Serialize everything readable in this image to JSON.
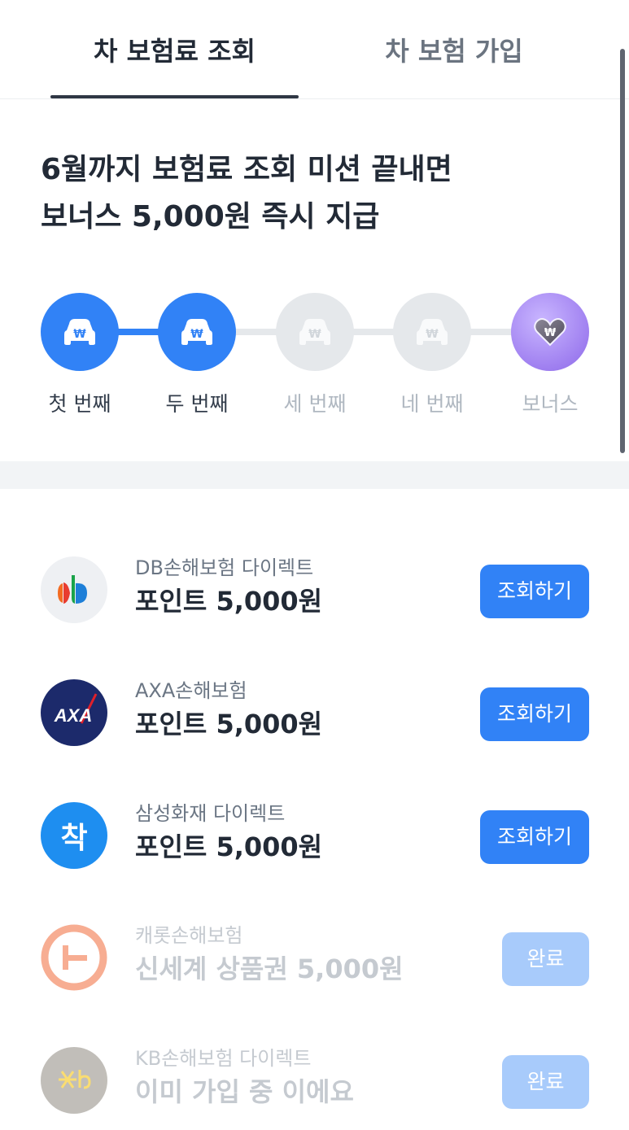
{
  "tabs": [
    {
      "label": "차 보험료 조회",
      "active": true
    },
    {
      "label": "차 보험 가입",
      "active": false
    }
  ],
  "headline": {
    "line1": "6월까지 보험료 조회 미션 끝내면",
    "line2": "보너스 5,000원 즉시 지급"
  },
  "steps": [
    {
      "label": "첫 번째",
      "status": "done",
      "icon": "car-won-icon"
    },
    {
      "label": "두 번째",
      "status": "done",
      "icon": "car-won-icon"
    },
    {
      "label": "세 번째",
      "status": "todo",
      "icon": "car-won-icon"
    },
    {
      "label": "네 번째",
      "status": "todo",
      "icon": "car-won-icon"
    },
    {
      "label": "보너스",
      "status": "bonus",
      "icon": "won-heart-icon"
    }
  ],
  "insurers": [
    {
      "name": "DB손해보험 다이렉트",
      "reward": "포인트 5,000원",
      "button": "조회하기",
      "state": "available",
      "logo": "db-logo"
    },
    {
      "name": "AXA손해보험",
      "reward": "포인트 5,000원",
      "button": "조회하기",
      "state": "available",
      "logo": "axa-logo"
    },
    {
      "name": "삼성화재 다이렉트",
      "reward": "포인트 5,000원",
      "button": "조회하기",
      "state": "available",
      "logo": "samsung-chak-logo"
    },
    {
      "name": "캐롯손해보험",
      "reward": "신세계 상품권 5,000원",
      "button": "완료",
      "state": "completed",
      "logo": "carrot-logo"
    },
    {
      "name": "KB손해보험 다이렉트",
      "reward": "이미 가입 중 이에요",
      "button": "완료",
      "state": "completed",
      "logo": "kb-logo"
    }
  ],
  "logo_text": {
    "axa": "AXA",
    "samsung": "착"
  },
  "colors": {
    "primary": "#3182f6",
    "primary_disabled": "#a8cbfb",
    "track_inactive": "#e5e8eb",
    "text_main": "#222a36",
    "text_sub": "#6b7684",
    "bonus_purple": "#9f7ff0",
    "axa_navy": "#1c2a6b",
    "samsung_blue": "#1e8ef0",
    "carrot_orange": "#f26b3a",
    "kb_gray": "#8f8a80"
  }
}
